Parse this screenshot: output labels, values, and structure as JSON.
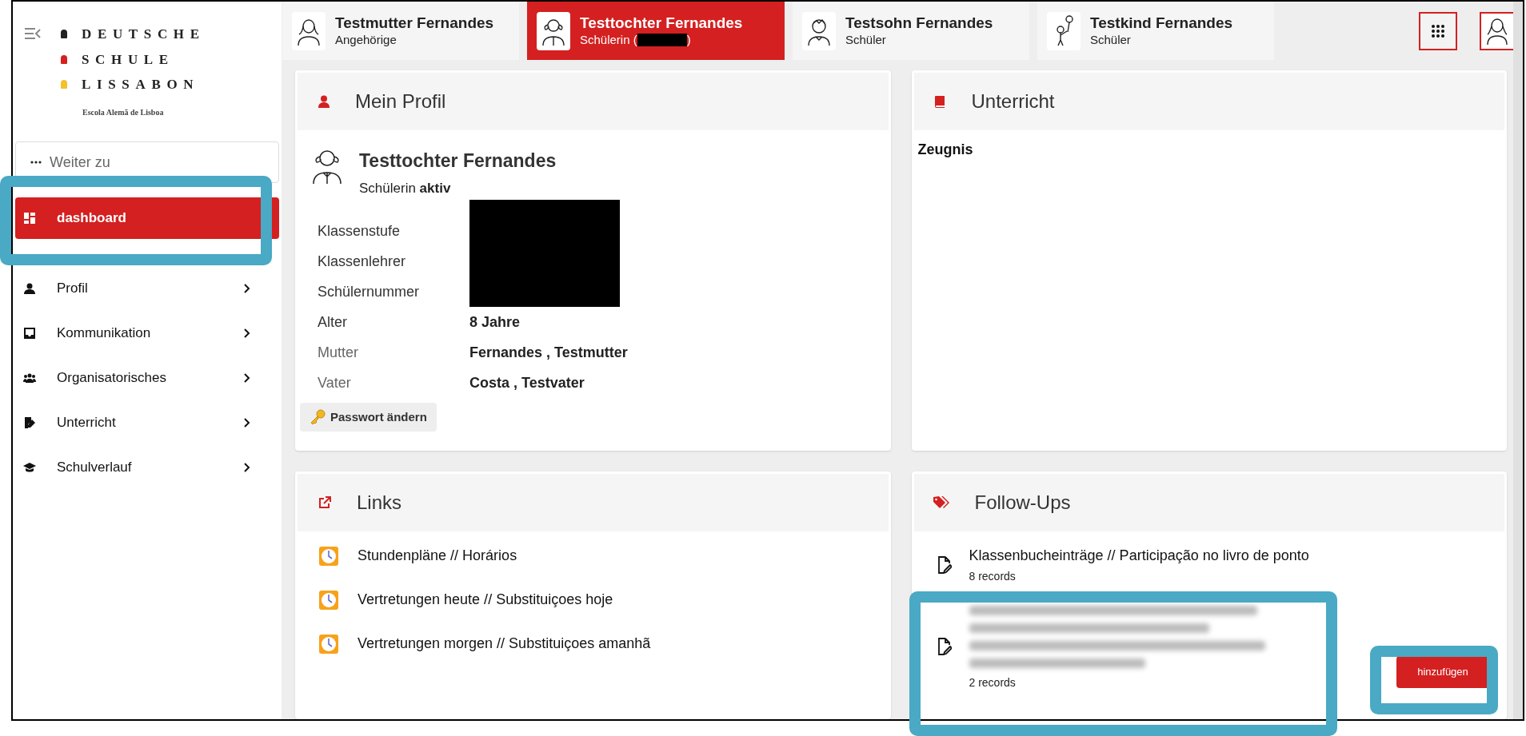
{
  "sidebar": {
    "logo": {
      "lines": [
        {
          "text": "DEUTSCHE",
          "color": "#222222"
        },
        {
          "text": "SCHULE",
          "color": "#d42020"
        },
        {
          "text": "LISSABON",
          "color": "#f2c12e"
        }
      ],
      "tagline": "Escola Alemã de Lisboa"
    },
    "search": {
      "placeholder": "Weiter zu"
    },
    "items": [
      {
        "label": "dashboard",
        "selected": true,
        "has_submenu": false
      },
      {
        "label": "Profil",
        "selected": false,
        "has_submenu": true
      },
      {
        "label": "Kommunikation",
        "selected": false,
        "has_submenu": true
      },
      {
        "label": "Organisatorisches",
        "selected": false,
        "has_submenu": true
      },
      {
        "label": "Unterricht",
        "selected": false,
        "has_submenu": true
      },
      {
        "label": "Schulverlauf",
        "selected": false,
        "has_submenu": true
      }
    ]
  },
  "tabs": [
    {
      "name": "Testmutter Fernandes",
      "role_parts": [
        "Angehörige"
      ],
      "selected": false
    },
    {
      "name": "Testtochter Fernandes",
      "role_parts": [
        "Schülerin (",
        ")"
      ],
      "selected": true
    },
    {
      "name": "Testsohn Fernandes",
      "role_parts": [
        "Schüler"
      ],
      "selected": false
    },
    {
      "name": "Testkind Fernandes",
      "role_parts": [
        "Schüler"
      ],
      "selected": false
    }
  ],
  "profile": {
    "title": "Mein Profil",
    "name": "Testtochter Fernandes",
    "status": "Schülerin **aktiv**",
    "fields": [
      {
        "label": "Klassenstufe",
        "redacted": true
      },
      {
        "label": "Klassenlehrer",
        "redacted": true
      },
      {
        "label": "Schülernummer",
        "redacted": true
      },
      {
        "label": "Alter",
        "value": "8 Jahre",
        "redacted": false
      },
      {
        "label": "Mutter",
        "value": "Fernandes , Testmutter",
        "redacted": false
      },
      {
        "label": "Vater",
        "value": "Costa , Testvater",
        "redacted": false
      }
    ],
    "button": "Passwort ändern"
  },
  "lessons": {
    "title": "Unterricht",
    "items": [
      "Zeugnis"
    ]
  },
  "links": {
    "title": "Links",
    "items": [
      "Stundenpläne // Horários",
      "Vertretungen heute // Substituiçoes hoje",
      "Vertretungen morgen // Substituiçoes amanhã"
    ]
  },
  "follow_ups": {
    "title": "Follow-Ups",
    "items": [
      {
        "title": "Klassenbucheinträge // Participação no livro de ponto",
        "count": "8 records",
        "blurred": false
      },
      {
        "count": "2 records",
        "blurred": true
      }
    ],
    "button": "hinzufügen"
  }
}
